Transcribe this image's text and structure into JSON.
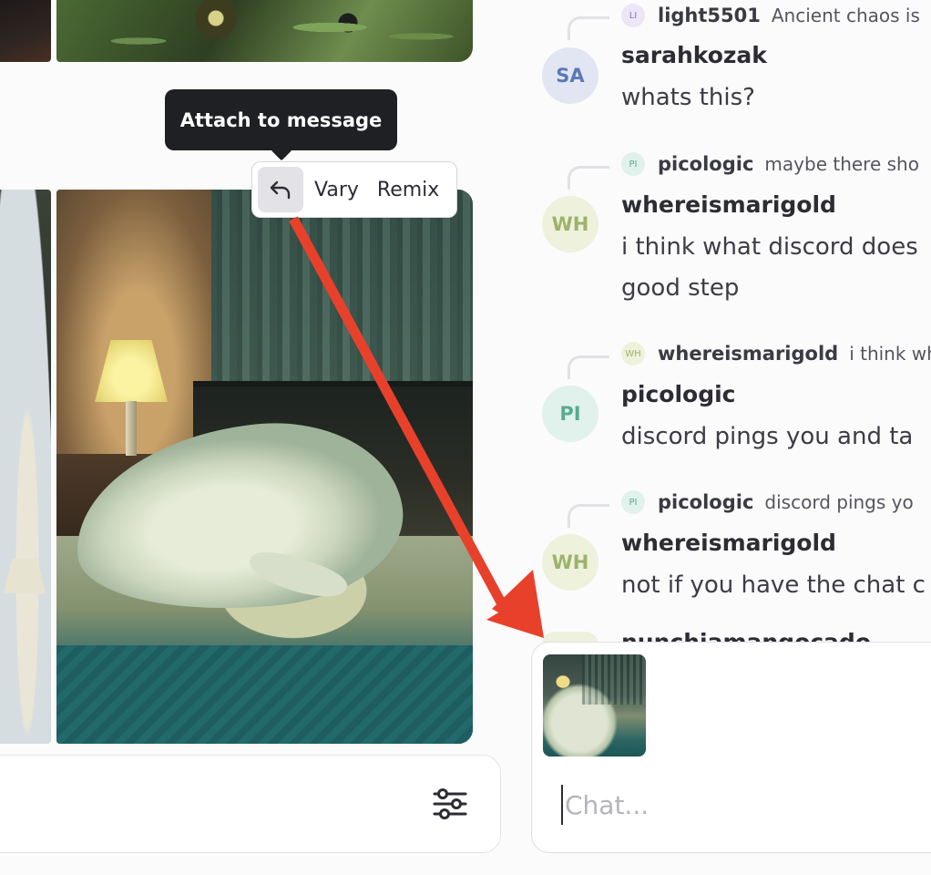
{
  "tooltip": {
    "text": "Attach to message"
  },
  "actions": {
    "vary_label": "Vary",
    "remix_label": "Remix"
  },
  "chat": {
    "messages": [
      {
        "reply_to_user": "light5501",
        "reply_to_initials": "LI",
        "reply_to_text": "Ancient chaos is",
        "initials": "SA",
        "username": "sarahkozak",
        "lines": [
          "whats this?"
        ]
      },
      {
        "reply_to_user": "picologic",
        "reply_to_initials": "PI",
        "reply_to_text": "maybe there sho",
        "initials": "WH",
        "username": "whereismarigold",
        "lines": [
          "i think what discord does",
          "good step"
        ]
      },
      {
        "reply_to_user": "whereismarigold",
        "reply_to_initials": "WH",
        "reply_to_text": "i think wh",
        "initials": "PI",
        "username": "picologic",
        "lines": [
          "discord pings you and ta"
        ]
      },
      {
        "reply_to_user": "picologic",
        "reply_to_initials": "PI",
        "reply_to_text": "discord pings yo",
        "initials": "WH",
        "username": "whereismarigold",
        "lines": [
          "not if you have the chat c"
        ]
      }
    ],
    "partial_next_username": "nunchiamangocado"
  },
  "composer": {
    "placeholder": "Chat..."
  },
  "icons": {
    "reply": "reply-arrow-icon",
    "filter": "sliders-icon"
  },
  "colors": {
    "arrow": "#e8412b",
    "tooltip_bg": "#1f2023"
  }
}
